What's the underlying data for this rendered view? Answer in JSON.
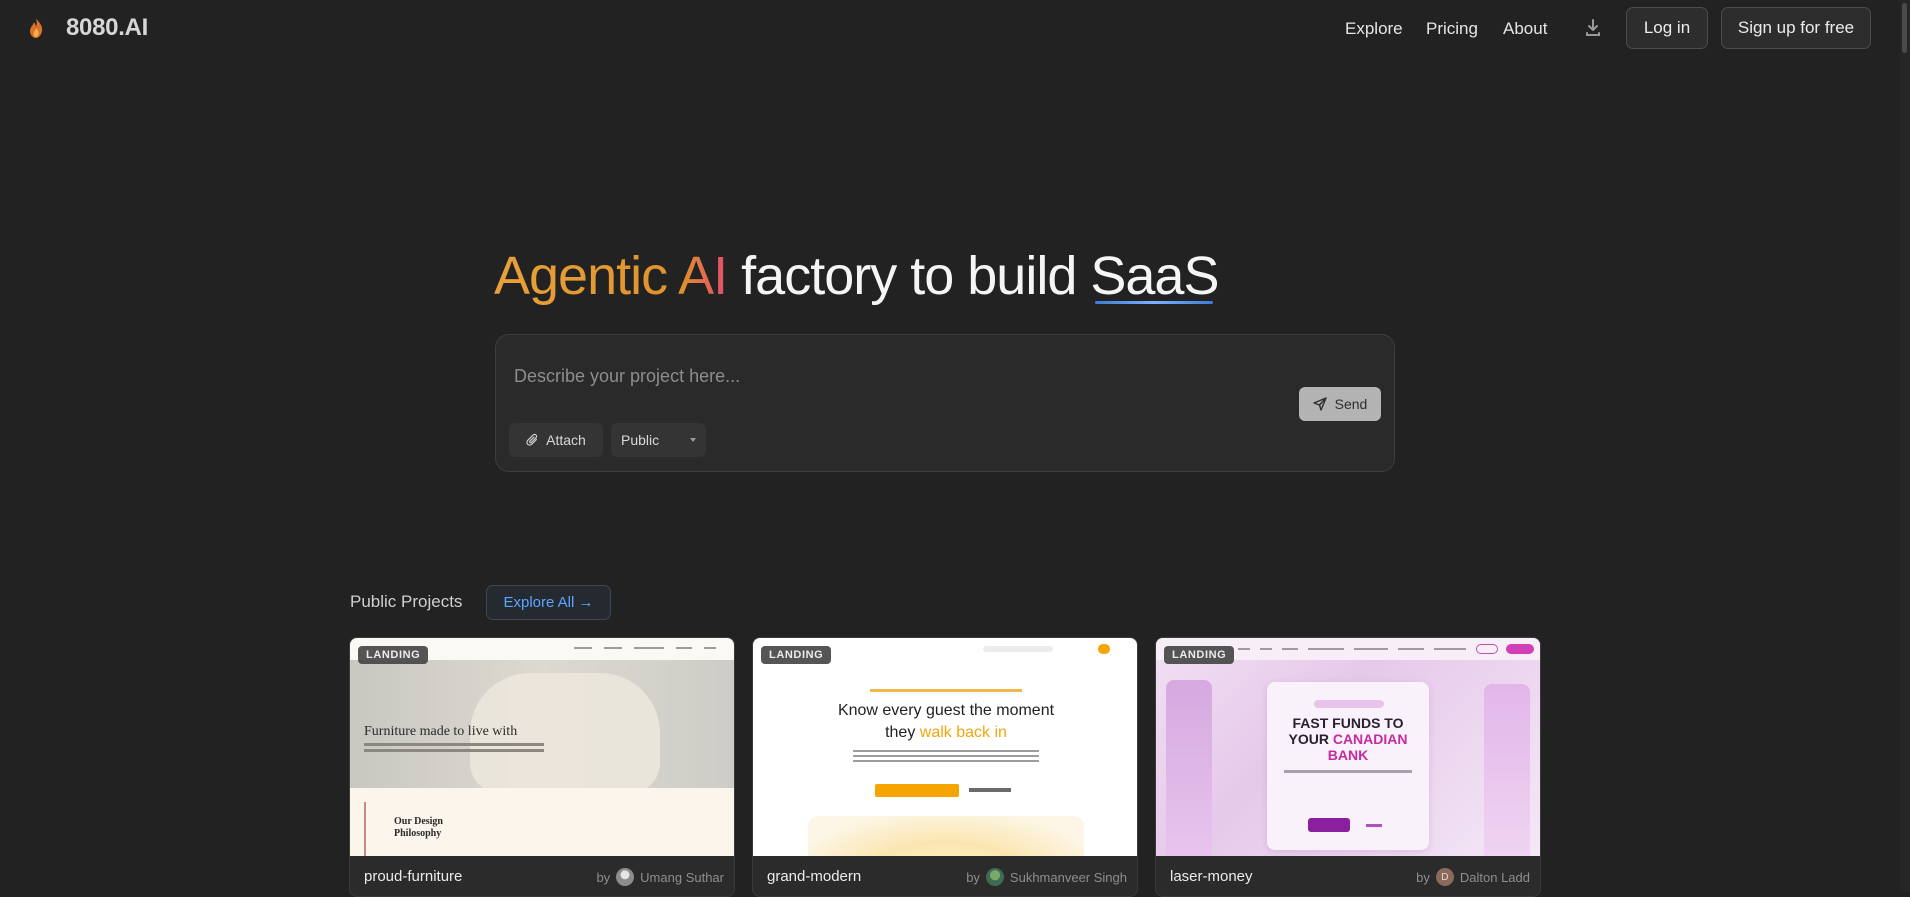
{
  "brand": {
    "name": "8080.AI",
    "logo_icon": "flame-logo-icon"
  },
  "nav": {
    "explore": "Explore",
    "pricing": "Pricing",
    "about": "About",
    "download_icon": "download-icon",
    "login": "Log in",
    "signup": "Sign up for free"
  },
  "hero": {
    "title_accent": "Agentic AI",
    "title_middle": " factory to build ",
    "title_end": "SaaS"
  },
  "prompt": {
    "placeholder": "Describe your project here...",
    "send_label": "Send",
    "attach_label": "Attach",
    "visibility_selected": "Public"
  },
  "projects": {
    "section_title": "Public Projects",
    "explore_all": "Explore All →",
    "cards": [
      {
        "badge": "LANDING",
        "name": "proud-furniture",
        "by": "by",
        "author": "Umang Suthar",
        "thumb_headline": "Furniture made to live with",
        "thumb_section": "Our Design Philosophy"
      },
      {
        "badge": "LANDING",
        "name": "grand-modern",
        "by": "by",
        "author": "Sukhmanveer Singh",
        "thumb_headline_a": "Know every guest the moment",
        "thumb_headline_b": "they ",
        "thumb_headline_c": "walk back in"
      },
      {
        "badge": "LANDING",
        "name": "laser-money",
        "by": "by",
        "author": "Dalton Ladd",
        "author_initial": "D",
        "thumb_headline_a": "FAST FUNDS TO",
        "thumb_headline_b": "YOUR ",
        "thumb_headline_c": "CANADIAN",
        "thumb_headline_d": "BANK"
      }
    ]
  },
  "colors": {
    "background": "#222222",
    "accent_orange": "#e8a13a",
    "link_blue": "#5aa5ff",
    "underline_blue": "#3d7bd8"
  }
}
